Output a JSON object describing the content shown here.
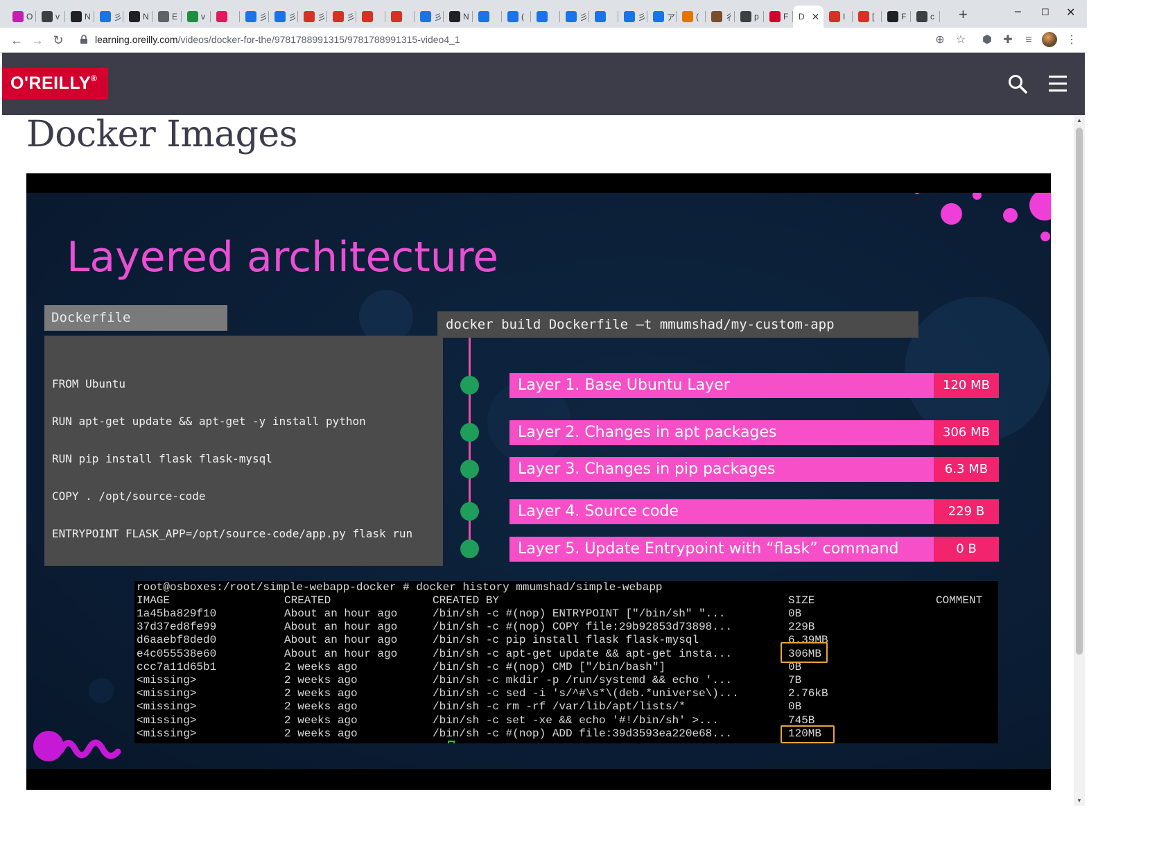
{
  "browser": {
    "tabs": [
      {
        "label": "O",
        "icon": "circle-logo-icon",
        "color": "#c51fb1"
      },
      {
        "label": "v",
        "icon": "dark-circle-icon",
        "color": "#3c4043"
      },
      {
        "label": "N",
        "icon": "dark-cat-icon",
        "color": "#202124"
      },
      {
        "label": "彡",
        "icon": "doc-icon",
        "color": "#1a73e8"
      },
      {
        "label": "N",
        "icon": "notion-icon",
        "color": "#202124"
      },
      {
        "label": "E",
        "icon": "gallery-icon",
        "color": "#5f6368"
      },
      {
        "label": "v",
        "icon": "green-app-icon",
        "color": "#1e8e3e"
      },
      {
        "label": "",
        "icon": "red-m-icon",
        "color": "#e8175d"
      },
      {
        "label": "彡",
        "icon": "zhihu-icon",
        "color": "#1a73e8"
      },
      {
        "label": "彡",
        "icon": "zhihu-icon",
        "color": "#1a73e8"
      },
      {
        "label": "彡",
        "icon": "red-box-icon",
        "color": "#d93025"
      },
      {
        "label": "彡",
        "icon": "target-icon",
        "color": "#d93025"
      },
      {
        "label": "",
        "icon": "flower-icon",
        "color": "#d93025"
      },
      {
        "label": "",
        "icon": "flower-icon",
        "color": "#d93025"
      },
      {
        "label": "彡",
        "icon": "zhihu-icon",
        "color": "#1a73e8"
      },
      {
        "label": "N",
        "icon": "notion-icon",
        "color": "#202124"
      },
      {
        "label": "",
        "icon": "tv-icon",
        "color": "#1a73e8"
      },
      {
        "label": "(",
        "icon": "tv-icon",
        "color": "#1a73e8"
      },
      {
        "label": "",
        "icon": "tv-icon",
        "color": "#1a73e8"
      },
      {
        "label": "彡",
        "icon": "tv-icon",
        "color": "#1a73e8"
      },
      {
        "label": "",
        "icon": "tv-icon",
        "color": "#1a73e8"
      },
      {
        "label": "彡",
        "icon": "zhihu-icon",
        "color": "#1a73e8"
      },
      {
        "label": "ア",
        "icon": "translate-icon",
        "color": "#1a73e8"
      },
      {
        "label": "(",
        "icon": "lightning-icon",
        "color": "#e37400"
      },
      {
        "label": "彳",
        "icon": "photo-icon",
        "color": "#7a4e2d"
      },
      {
        "label": "p",
        "icon": "dark-circle-icon",
        "color": "#3c4043"
      },
      {
        "label": "F",
        "icon": "oreilly-icon",
        "color": "#d3002d"
      },
      {
        "label": "D",
        "icon": "",
        "color": "#ffffff"
      },
      {
        "label": "I",
        "icon": "gmail-icon",
        "color": "#d93025"
      },
      {
        "label": "[",
        "icon": "gmail-icon",
        "color": "#d93025"
      },
      {
        "label": "F",
        "icon": "github-icon",
        "color": "#202124"
      },
      {
        "label": "c",
        "icon": "dark-circle-icon",
        "color": "#3c4043"
      }
    ],
    "url_domain": "learning.oreilly.com",
    "url_path": "/videos/docker-for-the/9781788991315/9781788991315-video4_1"
  },
  "site": {
    "logo_text": "O'REILLY",
    "logo_mark": "®"
  },
  "page": {
    "title": "Docker Images"
  },
  "slide": {
    "title": "Layered architecture",
    "dockerfile_tab": "Dockerfile",
    "dockerfile_lines": [
      "FROM Ubuntu",
      "RUN apt-get update && apt-get -y install python",
      "RUN pip install flask flask-mysql",
      "COPY . /opt/source-code",
      "ENTRYPOINT FLASK_APP=/opt/source-code/app.py flask run"
    ],
    "build_command": "docker build Dockerfile –t mmumshad/my-custom-app",
    "layers": [
      {
        "name": "Layer 1. Base Ubuntu Layer",
        "size": "120 MB"
      },
      {
        "name": "Layer 2. Changes in apt packages",
        "size": "306 MB"
      },
      {
        "name": "Layer 3. Changes in pip packages",
        "size": "6.3 MB"
      },
      {
        "name": "Layer 4. Source code",
        "size": "229 B"
      },
      {
        "name": "Layer 5. Update Entrypoint with “flask” command",
        "size": "0 B"
      }
    ],
    "colors": {
      "title": "#e94fd3",
      "layer_name_bg": "#f64fc8",
      "layer_size_bg": "#f2246e",
      "timeline": "#e94fa5",
      "timeline_dot": "#1f9d5a",
      "highlight_box": "#e8a23a"
    }
  },
  "terminal": {
    "prompt_line": "root@osboxes:/root/simple-webapp-docker # docker history mmumshad/simple-webapp",
    "headers": {
      "image": "IMAGE",
      "created": "CREATED",
      "created_by": "CREATED BY",
      "size": "SIZE",
      "comment": "COMMENT"
    },
    "rows": [
      {
        "image": "1a45ba829f10",
        "created": "About an hour ago",
        "created_by": "/bin/sh -c #(nop)  ENTRYPOINT [\"/bin/sh\" \"...",
        "size": "0B"
      },
      {
        "image": "37d37ed8fe99",
        "created": "About an hour ago",
        "created_by": "/bin/sh -c #(nop) COPY file:29b92853d73898...",
        "size": "229B"
      },
      {
        "image": "d6aaebf8ded0",
        "created": "About an hour ago",
        "created_by": "/bin/sh -c pip install flask flask-mysql",
        "size": "6.39MB"
      },
      {
        "image": "e4c055538e60",
        "created": "About an hour ago",
        "created_by": "/bin/sh -c apt-get update && apt-get insta...",
        "size": "306MB"
      },
      {
        "image": "ccc7a11d65b1",
        "created": "2 weeks ago",
        "created_by": "/bin/sh -c #(nop)  CMD [\"/bin/bash\"]",
        "size": "0B"
      },
      {
        "image": "<missing>",
        "created": "2 weeks ago",
        "created_by": "/bin/sh -c mkdir -p /run/systemd && echo '...",
        "size": "7B"
      },
      {
        "image": "<missing>",
        "created": "2 weeks ago",
        "created_by": "/bin/sh -c sed -i 's/^#\\s*\\(deb.*universe\\)...",
        "size": "2.76kB"
      },
      {
        "image": "<missing>",
        "created": "2 weeks ago",
        "created_by": "/bin/sh -c rm -rf /var/lib/apt/lists/*",
        "size": "0B"
      },
      {
        "image": "<missing>",
        "created": "2 weeks ago",
        "created_by": "/bin/sh -c set -xe    && echo '#!/bin/sh' >...",
        "size": "745B"
      },
      {
        "image": "<missing>",
        "created": "2 weeks ago",
        "created_by": "/bin/sh -c #(nop) ADD file:39d3593ea220e68...",
        "size": "120MB"
      }
    ]
  }
}
